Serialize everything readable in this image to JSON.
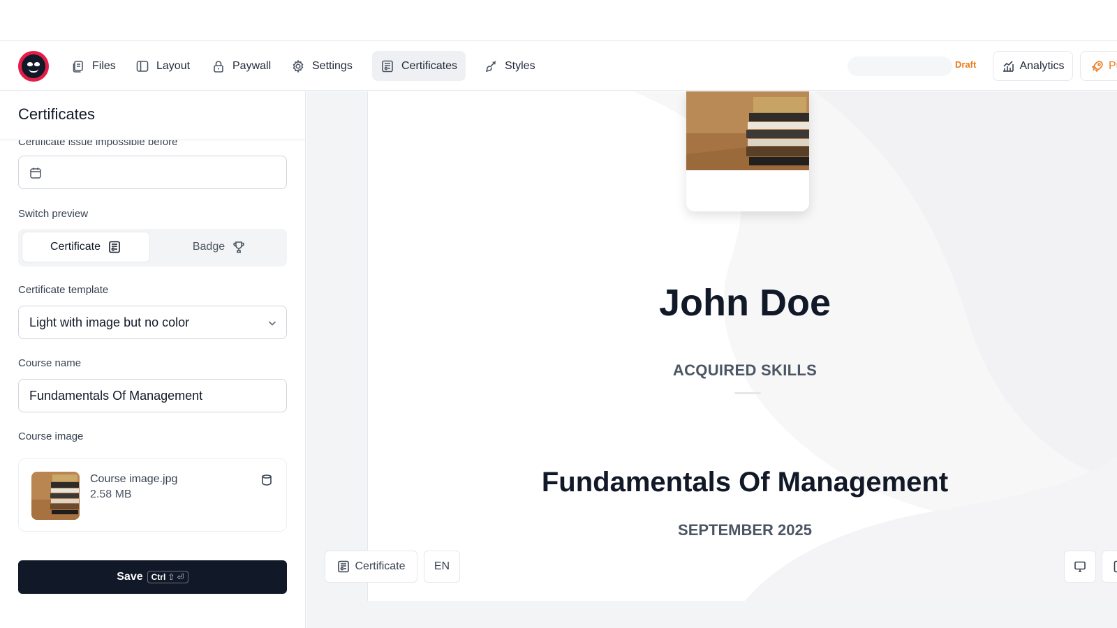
{
  "nav": {
    "items": [
      {
        "label": "Files",
        "icon": "files-icon"
      },
      {
        "label": "Layout",
        "icon": "layout-icon"
      },
      {
        "label": "Paywall",
        "icon": "lock-icon"
      },
      {
        "label": "Settings",
        "icon": "gear-icon"
      },
      {
        "label": "Certificates",
        "icon": "certificate-icon",
        "active": true
      },
      {
        "label": "Styles",
        "icon": "brush-icon"
      }
    ],
    "status_badge": "Draft",
    "analytics_label": "Analytics",
    "publish_label": "Pu"
  },
  "panel": {
    "title": "Certificates",
    "issue_date_label": "Certificate issue impossible before",
    "issue_date_value": "",
    "switch_preview_label": "Switch preview",
    "switch_options": [
      "Certificate",
      "Badge"
    ],
    "switch_selected": "Certificate",
    "template_label": "Certificate template",
    "template_value": "Light with image but no color",
    "course_name_label": "Course name",
    "course_name_value": "Fundamentals Of Management",
    "course_image_label": "Course image",
    "image_file": {
      "name": "Course image.jpg",
      "size": "2.58 MB"
    },
    "save": {
      "label": "Save",
      "shortcut_key": "Ctrl",
      "shortcut_rest": "⇧ ⏎"
    }
  },
  "preview": {
    "recipient_name": "John Doe",
    "skills_heading": "ACQUIRED SKILLS",
    "course_title": "Fundamentals Of Management",
    "date": "SEPTEMBER 2025",
    "mode_button_label": "Certificate",
    "language_button_label": "EN"
  },
  "colors": {
    "accent_orange": "#ea7a1a",
    "logo_red": "#e11d48",
    "save_button_bg": "#111827",
    "active_tab_bg": "#eef0f3"
  }
}
